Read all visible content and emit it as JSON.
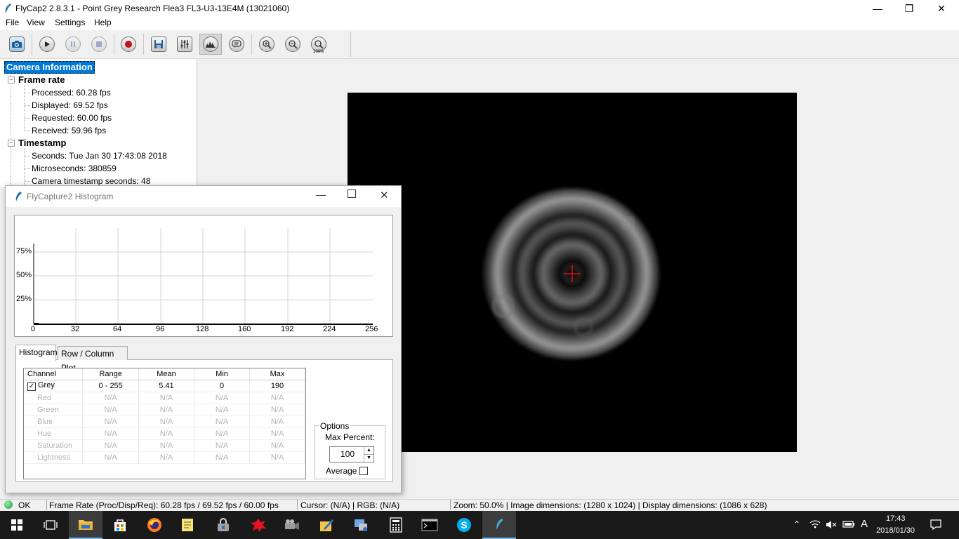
{
  "window": {
    "title": "FlyCap2 2.8.3.1 - Point Grey Research Flea3 FL3-U3-13E4M (13021060)"
  },
  "menu": [
    "File",
    "View",
    "Settings",
    "Help"
  ],
  "toolbar": {
    "buttons": [
      "camera-icon",
      "play-icon",
      "pause-icon",
      "stop-icon",
      "record-icon",
      "save-icon",
      "settings-sliders-icon",
      "histogram-icon",
      "info-icon",
      "zoom-in-icon",
      "zoom-out-icon",
      "zoom-100-icon"
    ],
    "zoom_100_label": "100%"
  },
  "tree": {
    "root": "Camera Information",
    "groups": [
      {
        "label": "Frame rate",
        "items": [
          "Processed: 60.28 fps",
          "Displayed: 69.52 fps",
          "Requested: 60.00 fps",
          "Received: 59.96 fps"
        ]
      },
      {
        "label": "Timestamp",
        "items": [
          "Seconds: Tue Jan 30 17:43:08 2018",
          "Microseconds: 380859",
          "Camera timestamp seconds: 48"
        ]
      }
    ]
  },
  "histogram_window": {
    "title": "FlyCapture2 Histogram",
    "tabs": [
      "Histogram",
      "Row / Column Plot"
    ],
    "active_tab": 0,
    "columns": [
      "Channel",
      "Range",
      "Mean",
      "Min",
      "Max"
    ],
    "rows": [
      {
        "channel": "Grey",
        "range": "0 - 255",
        "mean": "5.41",
        "min": "0",
        "max": "190",
        "enabled": true
      },
      {
        "channel": "Red",
        "range": "N/A",
        "mean": "N/A",
        "min": "N/A",
        "max": "N/A",
        "enabled": false
      },
      {
        "channel": "Green",
        "range": "N/A",
        "mean": "N/A",
        "min": "N/A",
        "max": "N/A",
        "enabled": false
      },
      {
        "channel": "Blue",
        "range": "N/A",
        "mean": "N/A",
        "min": "N/A",
        "max": "N/A",
        "enabled": false
      },
      {
        "channel": "Hue",
        "range": "N/A",
        "mean": "N/A",
        "min": "N/A",
        "max": "N/A",
        "enabled": false
      },
      {
        "channel": "Saturation",
        "range": "N/A",
        "mean": "N/A",
        "min": "N/A",
        "max": "N/A",
        "enabled": false
      },
      {
        "channel": "Lightness",
        "range": "N/A",
        "mean": "N/A",
        "min": "N/A",
        "max": "N/A",
        "enabled": false
      }
    ],
    "options": {
      "legend": "Options",
      "max_percent_label": "Max Percent:",
      "max_percent_value": "100",
      "average_label": "Average",
      "average_checked": false
    },
    "plot": {
      "y_ticks": [
        "75%",
        "50%",
        "25%"
      ],
      "x_ticks": [
        "0",
        "32",
        "64",
        "96",
        "128",
        "160",
        "192",
        "224",
        "256"
      ]
    }
  },
  "status": {
    "state": "OK",
    "frame_rate": "Frame Rate (Proc/Disp/Req): 60.28 fps / 69.52 fps / 60.00 fps",
    "cursor": "Cursor: (N/A) | RGB: (N/A)",
    "zoom": "Zoom: 50.0% | Image dimensions: (1280 x 1024) | Display dimensions: (1086 x 628)",
    "ok_color": "#22b14c"
  },
  "taskbar": {
    "apps": [
      "start-icon",
      "task-view-icon",
      "file-explorer-icon",
      "store-icon",
      "firefox-icon",
      "notes-icon",
      "security-icon",
      "paint-splash-icon",
      "media-icon",
      "edit-icon",
      "network-app-icon",
      "calculator-icon",
      "terminal-icon",
      "skype-icon",
      "flycap-icon"
    ],
    "time": "17:43",
    "date": "2018/01/30",
    "ime": "A"
  },
  "colors": {
    "selection": "#0078d7",
    "taskbar": "#1a1a1a",
    "crosshair": "#e01010"
  }
}
